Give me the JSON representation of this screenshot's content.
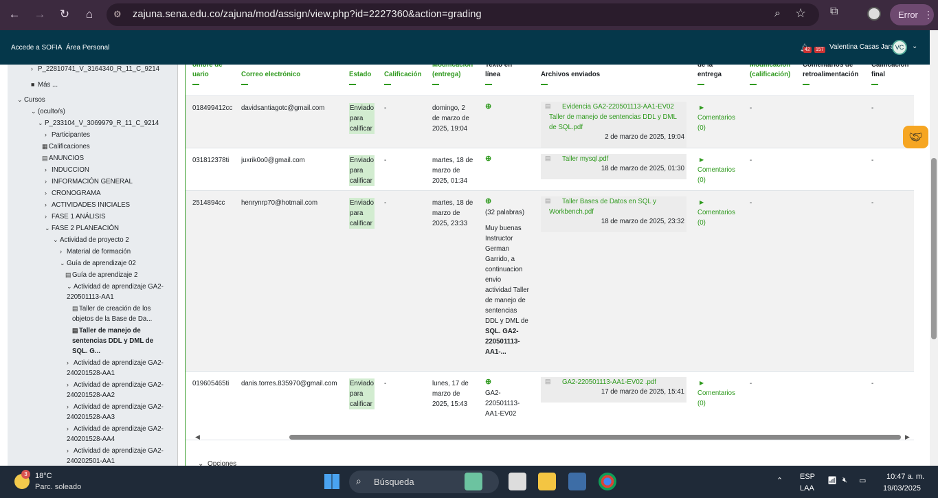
{
  "browser": {
    "url": "zajuna.sena.edu.co/zajuna/mod/assign/view.php?id=2227360&action=grading",
    "profile_status": "Error"
  },
  "topnav": {
    "link1": "Accede a SOFIA",
    "link2": "Área Personal",
    "notif_count": "42",
    "msg_count": "157",
    "user_name": "Valentina Casas Jara",
    "user_initials": "VC"
  },
  "sidebar": {
    "items": [
      {
        "label": "P_22810741_V_3164340_R_11_C_9214",
        "chev": "›",
        "bold": false
      },
      {
        "label": "Más ...",
        "chev": "■",
        "bold": false
      },
      {
        "label": "Cursos",
        "chev": "⌄",
        "bold": false
      },
      {
        "label": "(oculto/s)",
        "chev": "⌄",
        "bold": false
      },
      {
        "label": "P_233104_V_3069979_R_11_C_9214",
        "chev": "⌄",
        "bold": false
      },
      {
        "label": "Participantes",
        "chev": "›",
        "bold": false
      },
      {
        "label": "Calificaciones",
        "chev": "▦",
        "bold": false
      },
      {
        "label": "ANUNCIOS",
        "chev": "▤",
        "bold": false
      },
      {
        "label": "INDUCCION",
        "chev": "›",
        "bold": false
      },
      {
        "label": "INFORMACIÓN GENERAL",
        "chev": "›",
        "bold": false
      },
      {
        "label": "CRONOGRAMA",
        "chev": "›",
        "bold": false
      },
      {
        "label": "ACTIVIDADES INICIALES",
        "chev": "›",
        "bold": false
      },
      {
        "label": "FASE 1 ANÁLISIS",
        "chev": "›",
        "bold": false
      },
      {
        "label": "FASE 2 PLANEACIÓN",
        "chev": "⌄",
        "bold": false
      },
      {
        "label": "Actividad de proyecto 2",
        "chev": "⌄",
        "bold": false
      },
      {
        "label": "Material de formación",
        "chev": "›",
        "bold": false
      },
      {
        "label": "Guía de aprendizaje 02",
        "chev": "⌄",
        "bold": false
      },
      {
        "label": "Guía de aprendizaje 2",
        "chev": "▤",
        "bold": false
      },
      {
        "label": "Actividad de aprendizaje GA2-",
        "label2": "220501113-AA1",
        "chev": "⌄",
        "bold": false
      },
      {
        "label": "Taller de creación de los",
        "label2": "objetos de la Base de Da...",
        "chev": "▤",
        "bold": false
      },
      {
        "label": "Taller de manejo de",
        "label2": "sentencias DDL y DML de",
        "label3": "SQL. G...",
        "chev": "▤",
        "bold": true
      },
      {
        "label": "Actividad de aprendizaje GA2-",
        "label2": "240201528-AA1",
        "chev": "›",
        "bold": false
      },
      {
        "label": "Actividad de aprendizaje GA2-",
        "label2": "240201528-AA2",
        "chev": "›",
        "bold": false
      },
      {
        "label": "Actividad de aprendizaje GA2-",
        "label2": "240201528-AA3",
        "chev": "›",
        "bold": false
      },
      {
        "label": "Actividad de aprendizaje GA2-",
        "label2": "240201528-AA4",
        "chev": "›",
        "bold": false
      },
      {
        "label": "Actividad de aprendizaje GA2-",
        "label2": "240202501-AA1",
        "chev": "›",
        "bold": false
      }
    ]
  },
  "table": {
    "headers": {
      "user_a": "ombre de",
      "user_b": "uario",
      "email": "Correo electrónico",
      "status": "Estado",
      "grade": "Calificación",
      "modified_a": "Modificación",
      "modified_b": "(entrega)",
      "online_a": "Texto en",
      "online_b": "línea",
      "files": "Archivos enviados",
      "sub_a": "de la",
      "sub_b": "entrega",
      "modgrade_a": "Modificación",
      "modgrade_b": "(calificación)",
      "feedback_a": "Comentarios de",
      "feedback_b": "retroalimentación",
      "final_a": "Calificación",
      "final_b": "final"
    },
    "rows": [
      {
        "user": "018499412cc",
        "email": "davidsantiagotc@gmail.com",
        "status": [
          "Enviado",
          "para",
          "calificar"
        ],
        "grade": "-",
        "modified": [
          "domingo, 2",
          "de marzo de",
          "2025, 19:04"
        ],
        "online": [],
        "file_lines": [
          "Evidencia GA2-220501113-AA1-EV02",
          "Taller de manejo de sentencias DDL y DML",
          "de SQL.pdf"
        ],
        "file_date": "2 de marzo de 2025, 19:04",
        "comments": [
          "Comentarios",
          "(0)"
        ],
        "modgrade": "-",
        "final": "-"
      },
      {
        "user": "031812378ti",
        "email": "juxrik0o0@gmail.com",
        "status": [
          "Enviado",
          "para",
          "calificar"
        ],
        "grade": "-",
        "modified": [
          "martes, 18 de",
          "marzo de",
          "2025, 01:34"
        ],
        "online": [],
        "file_lines": [
          "Taller mysql.pdf"
        ],
        "file_date": "18 de marzo de 2025, 01:30",
        "comments": [
          "Comentarios",
          "(0)"
        ],
        "modgrade": "-",
        "final": "-"
      },
      {
        "user": "2514894cc",
        "email": "henrynrp70@hotmail.com",
        "status": [
          "Enviado",
          "para",
          "calificar"
        ],
        "grade": "-",
        "modified": [
          "martes, 18 de",
          "marzo de",
          "2025, 23:33"
        ],
        "online": [
          "(32 palabras)",
          "",
          "Muy buenas",
          "Instructor",
          "German",
          "Garrido, a",
          "continuacion",
          "envio",
          "actividad Taller",
          "de manejo de",
          "sentencias",
          "DDL y DML de",
          "SQL. GA2-",
          "220501113-",
          "AA1-..."
        ],
        "file_lines": [
          "Taller Bases de Datos en SQL y",
          "Workbench.pdf"
        ],
        "file_date": "18 de marzo de 2025, 23:32",
        "comments": [
          "Comentarios",
          "(0)"
        ],
        "modgrade": "-",
        "final": "-"
      },
      {
        "user": "019605465ti",
        "email": "danis.torres.835970@gmail.com",
        "status": [
          "Enviado",
          "para",
          "calificar"
        ],
        "grade": "-",
        "modified": [
          "lunes, 17 de",
          "marzo de",
          "2025, 15:43"
        ],
        "online": [
          "GA2-",
          "220501113-",
          "AA1-EV02"
        ],
        "file_lines": [
          "GA2-220501113-AA1-EV02 .pdf"
        ],
        "file_date": "17 de marzo de 2025, 15:41",
        "comments": [
          "Comentarios",
          "(0)"
        ],
        "modgrade": "-",
        "final": "-"
      }
    ]
  },
  "options_label": "Opciones",
  "taskbar": {
    "temp": "18°C",
    "condition": "Parc. soleado",
    "weather_badge": "3",
    "search": "Búsqueda",
    "lang1": "ESP",
    "lang2": "LAA",
    "time": "10:47 a. m.",
    "date": "19/03/2025"
  }
}
